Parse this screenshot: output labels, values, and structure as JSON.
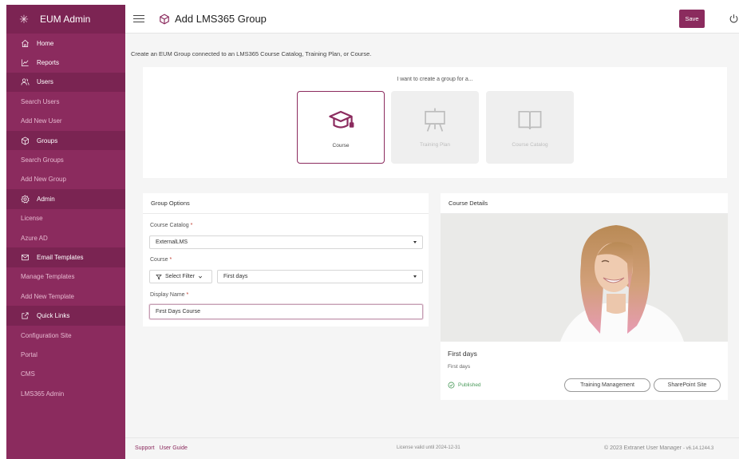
{
  "app": {
    "brand": "EUM Admin",
    "page_title": "Add LMS365 Group",
    "save_label": "Save"
  },
  "sidebar": {
    "items": [
      {
        "label": "Home",
        "kind": "top",
        "icon": "home-icon"
      },
      {
        "label": "Reports",
        "kind": "top",
        "icon": "chart-icon"
      },
      {
        "label": "Users",
        "kind": "section",
        "icon": "users-icon"
      },
      {
        "label": "Search Users",
        "kind": "sub"
      },
      {
        "label": "Add New User",
        "kind": "sub"
      },
      {
        "label": "Groups",
        "kind": "section",
        "icon": "groups-icon"
      },
      {
        "label": "Search Groups",
        "kind": "sub"
      },
      {
        "label": "Add New Group",
        "kind": "sub"
      },
      {
        "label": "Admin",
        "kind": "section",
        "icon": "gear-icon"
      },
      {
        "label": "License",
        "kind": "sub"
      },
      {
        "label": "Azure AD",
        "kind": "sub"
      },
      {
        "label": "Email Templates",
        "kind": "section",
        "icon": "mail-icon"
      },
      {
        "label": "Manage Templates",
        "kind": "sub"
      },
      {
        "label": "Add New Template",
        "kind": "sub"
      },
      {
        "label": "Quick Links",
        "kind": "section",
        "icon": "external-link-icon"
      },
      {
        "label": "Configuration Site",
        "kind": "sub"
      },
      {
        "label": "Portal",
        "kind": "sub"
      },
      {
        "label": "CMS",
        "kind": "sub"
      },
      {
        "label": "LMS365 Admin",
        "kind": "sub"
      }
    ]
  },
  "main": {
    "intro": "Create an EUM Group connected to an LMS365 Course Catalog, Training Plan, or Course.",
    "type_prompt": "I want to create a group for a...",
    "types": [
      {
        "label": "Course",
        "selected": true,
        "icon": "graduation-cap-icon"
      },
      {
        "label": "Training Plan",
        "selected": false,
        "icon": "presentation-board-icon"
      },
      {
        "label": "Course Catalog",
        "selected": false,
        "icon": "open-book-icon"
      }
    ]
  },
  "group_options": {
    "title": "Group Options",
    "catalog_label": "Course Catalog",
    "catalog_value": "ExternalLMS",
    "course_label": "Course",
    "filter_label": "Select Filter",
    "course_value": "First days",
    "display_name_label": "Display Name",
    "display_name_value": "First Days Course",
    "required_marker": "*"
  },
  "course_details": {
    "title": "Course Details",
    "course_name": "First days",
    "course_sub": "First days",
    "status": "Published",
    "btn_training": "Training Management",
    "btn_sharepoint": "SharePoint Site"
  },
  "footer": {
    "support": "Support",
    "user_guide": "User Guide",
    "license": "License valid until 2024-12-31",
    "copyright": "© 2023 Extranet User Manager",
    "version": "- v6.14.1244.3"
  },
  "colors": {
    "brand": "#8b2b5e",
    "sidebar_section": "#7a2452",
    "status_green": "#4a9a5a"
  }
}
